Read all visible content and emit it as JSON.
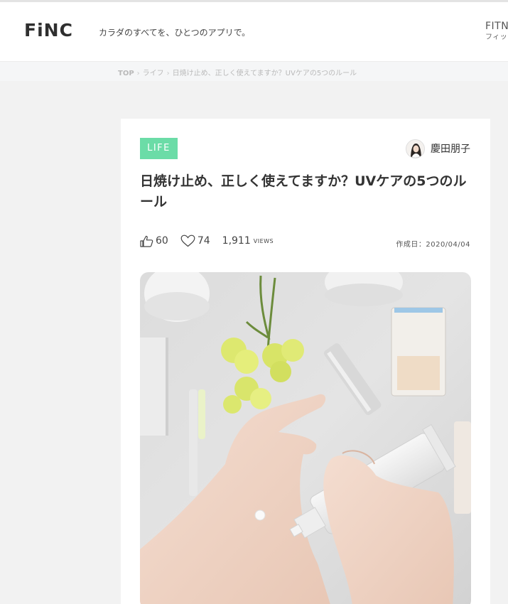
{
  "header": {
    "logo": "FiNC",
    "tagline": "カラダのすべてを、ひとつのアプリで。",
    "nav_fitness": "FITN",
    "nav_fitness_sub": "フィッ"
  },
  "breadcrumb": {
    "items": [
      "TOP",
      "ライフ",
      "日焼け止め、正しく使えてますか？UVケアの5つのルール"
    ],
    "separator": "›"
  },
  "article": {
    "category": "LIFE",
    "category_color": "#6bdca7",
    "author": "慶田朋子",
    "title": "日焼け止め、正しく使えてますか？UVケアの5つのルール",
    "likes": "60",
    "favorites": "74",
    "views": "1,911",
    "views_unit": "VIEWS",
    "date": "作成日：2020/04/04"
  },
  "icons": {
    "like": "thumbs-up-icon",
    "favorite": "heart-icon"
  }
}
